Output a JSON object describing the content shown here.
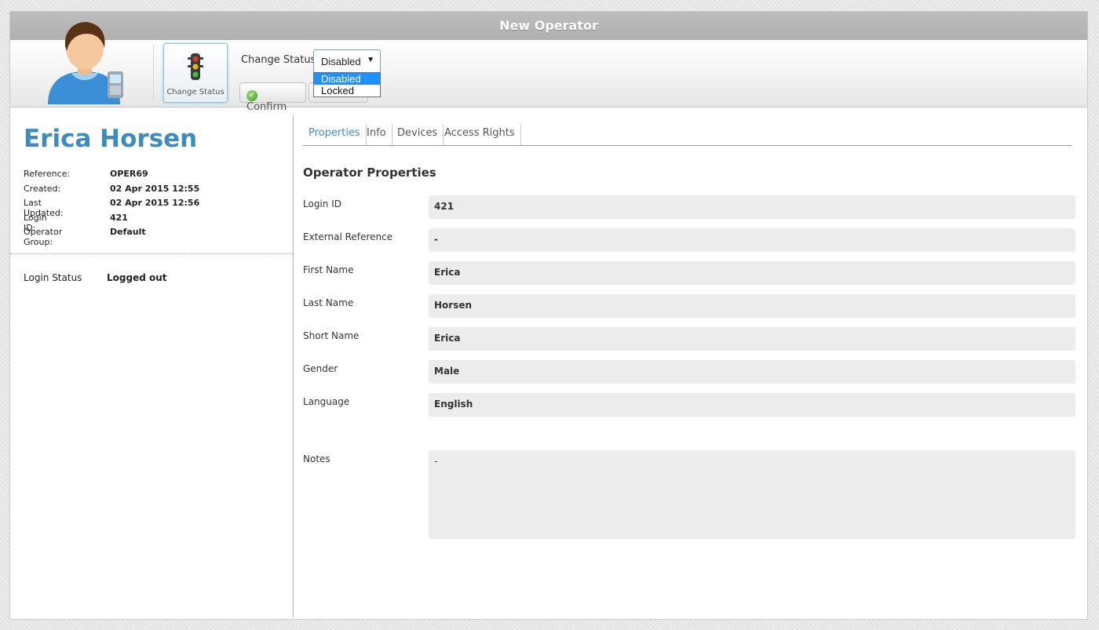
{
  "window": {
    "title": "New Operator"
  },
  "toolbar": {
    "change_status_tile_label": "Change Status",
    "change_status_label": "Change Status",
    "status_select": {
      "value": "Disabled",
      "options": [
        "Disabled",
        "Locked"
      ]
    },
    "confirm_label": "Confirm"
  },
  "operator": {
    "name": "Erica Horsen",
    "meta": [
      {
        "label": "Reference:",
        "value": "OPER69"
      },
      {
        "label": "Created:",
        "value": "02 Apr 2015 12:55"
      },
      {
        "label": "Last Updated:",
        "value": "02 Apr 2015 12:56"
      },
      {
        "label": "Login ID:",
        "value": "421"
      },
      {
        "label": "Operator Group:",
        "value": "Default"
      }
    ],
    "login_status": {
      "label": "Login Status",
      "value": "Logged out"
    }
  },
  "tabs": [
    "Properties",
    "Info",
    "Devices",
    "Access Rights"
  ],
  "properties": {
    "title": "Operator Properties",
    "fields": [
      {
        "label": "Login ID",
        "value": "421"
      },
      {
        "label": "External Reference",
        "value": "-"
      },
      {
        "label": "First Name",
        "value": "Erica"
      },
      {
        "label": "Last Name",
        "value": "Horsen"
      },
      {
        "label": "Short Name",
        "value": "Erica"
      },
      {
        "label": "Gender",
        "value": "Male"
      },
      {
        "label": "Language",
        "value": "English"
      }
    ],
    "notes": {
      "label": "Notes",
      "value": "-"
    }
  },
  "colors": {
    "accent": "#3d8cbb",
    "titlebar": "#b5b5b5",
    "field_bg": "#ececec",
    "selected_option": "#1e90ff"
  }
}
